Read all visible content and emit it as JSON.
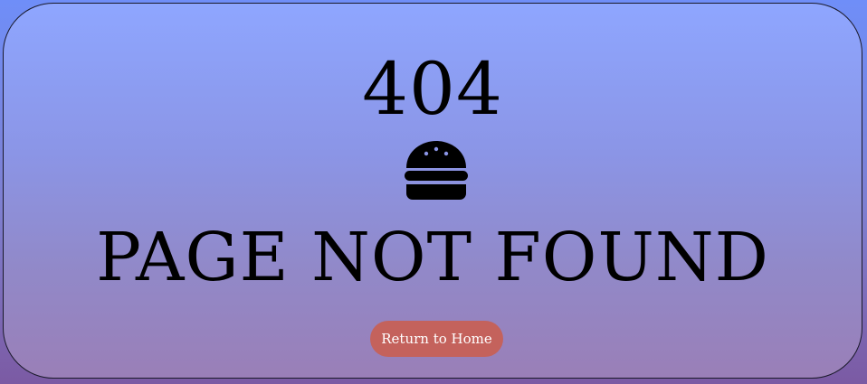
{
  "error": {
    "code": "404",
    "icon": "hamburger-icon",
    "message": "PAGE NOT FOUND"
  },
  "actions": {
    "home_label": "Return to Home"
  },
  "colors": {
    "page_gradient_top": "#6f8ef8",
    "page_gradient_bottom": "#7b5aa3",
    "card_gradient_top": "#8ea6ff",
    "card_gradient_bottom": "#9a7fb7",
    "button_bg": "#c4625c",
    "button_text": "#ffffff",
    "text": "#000000"
  }
}
